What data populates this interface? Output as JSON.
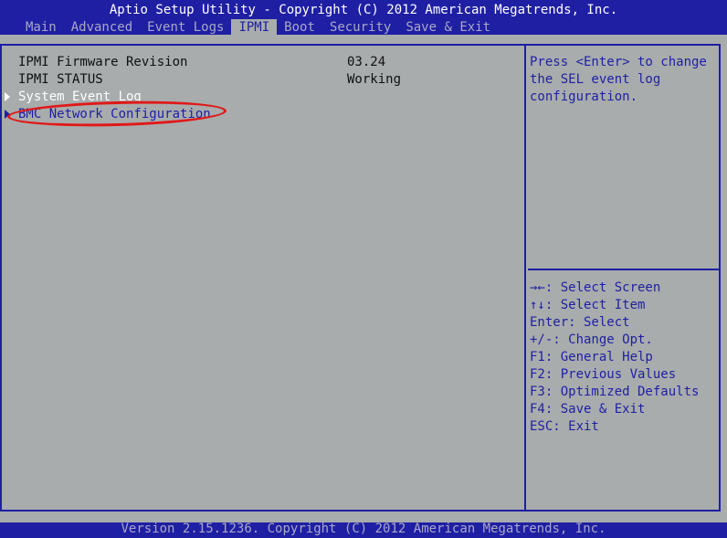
{
  "header": {
    "title": "Aptio Setup Utility - Copyright (C) 2012 American Megatrends, Inc.",
    "tabs": [
      {
        "label": "Main"
      },
      {
        "label": "Advanced"
      },
      {
        "label": "Event Logs"
      },
      {
        "label": "IPMI"
      },
      {
        "label": "Boot"
      },
      {
        "label": "Security"
      },
      {
        "label": "Save & Exit"
      }
    ],
    "active_tab": "IPMI"
  },
  "main": {
    "info": [
      {
        "label": "IPMI Firmware Revision",
        "value": "03.24"
      },
      {
        "label": "IPMI STATUS",
        "value": "Working"
      }
    ],
    "submenus": [
      {
        "label": "System Event Log"
      },
      {
        "label": "BMC Network Configuration"
      }
    ],
    "selected_submenu": "BMC Network Configuration"
  },
  "help": {
    "text": "Press <Enter> to change the SEL event log configuration."
  },
  "keys": [
    {
      "text": "→←: Select Screen"
    },
    {
      "text": "↑↓: Select Item"
    },
    {
      "text": "Enter: Select"
    },
    {
      "text": "+/-: Change Opt."
    },
    {
      "text": "F1: General Help"
    },
    {
      "text": "F2: Previous Values"
    },
    {
      "text": "F3: Optimized Defaults"
    },
    {
      "text": "F4: Save & Exit"
    },
    {
      "text": "ESC: Exit"
    }
  ],
  "footer": {
    "text": "Version 2.15.1236. Copyright (C) 2012 American Megatrends, Inc."
  },
  "colors": {
    "bios_blue": "#1f1fa4",
    "background_gray": "#a8acac",
    "highlight_oval": "#e01818"
  }
}
